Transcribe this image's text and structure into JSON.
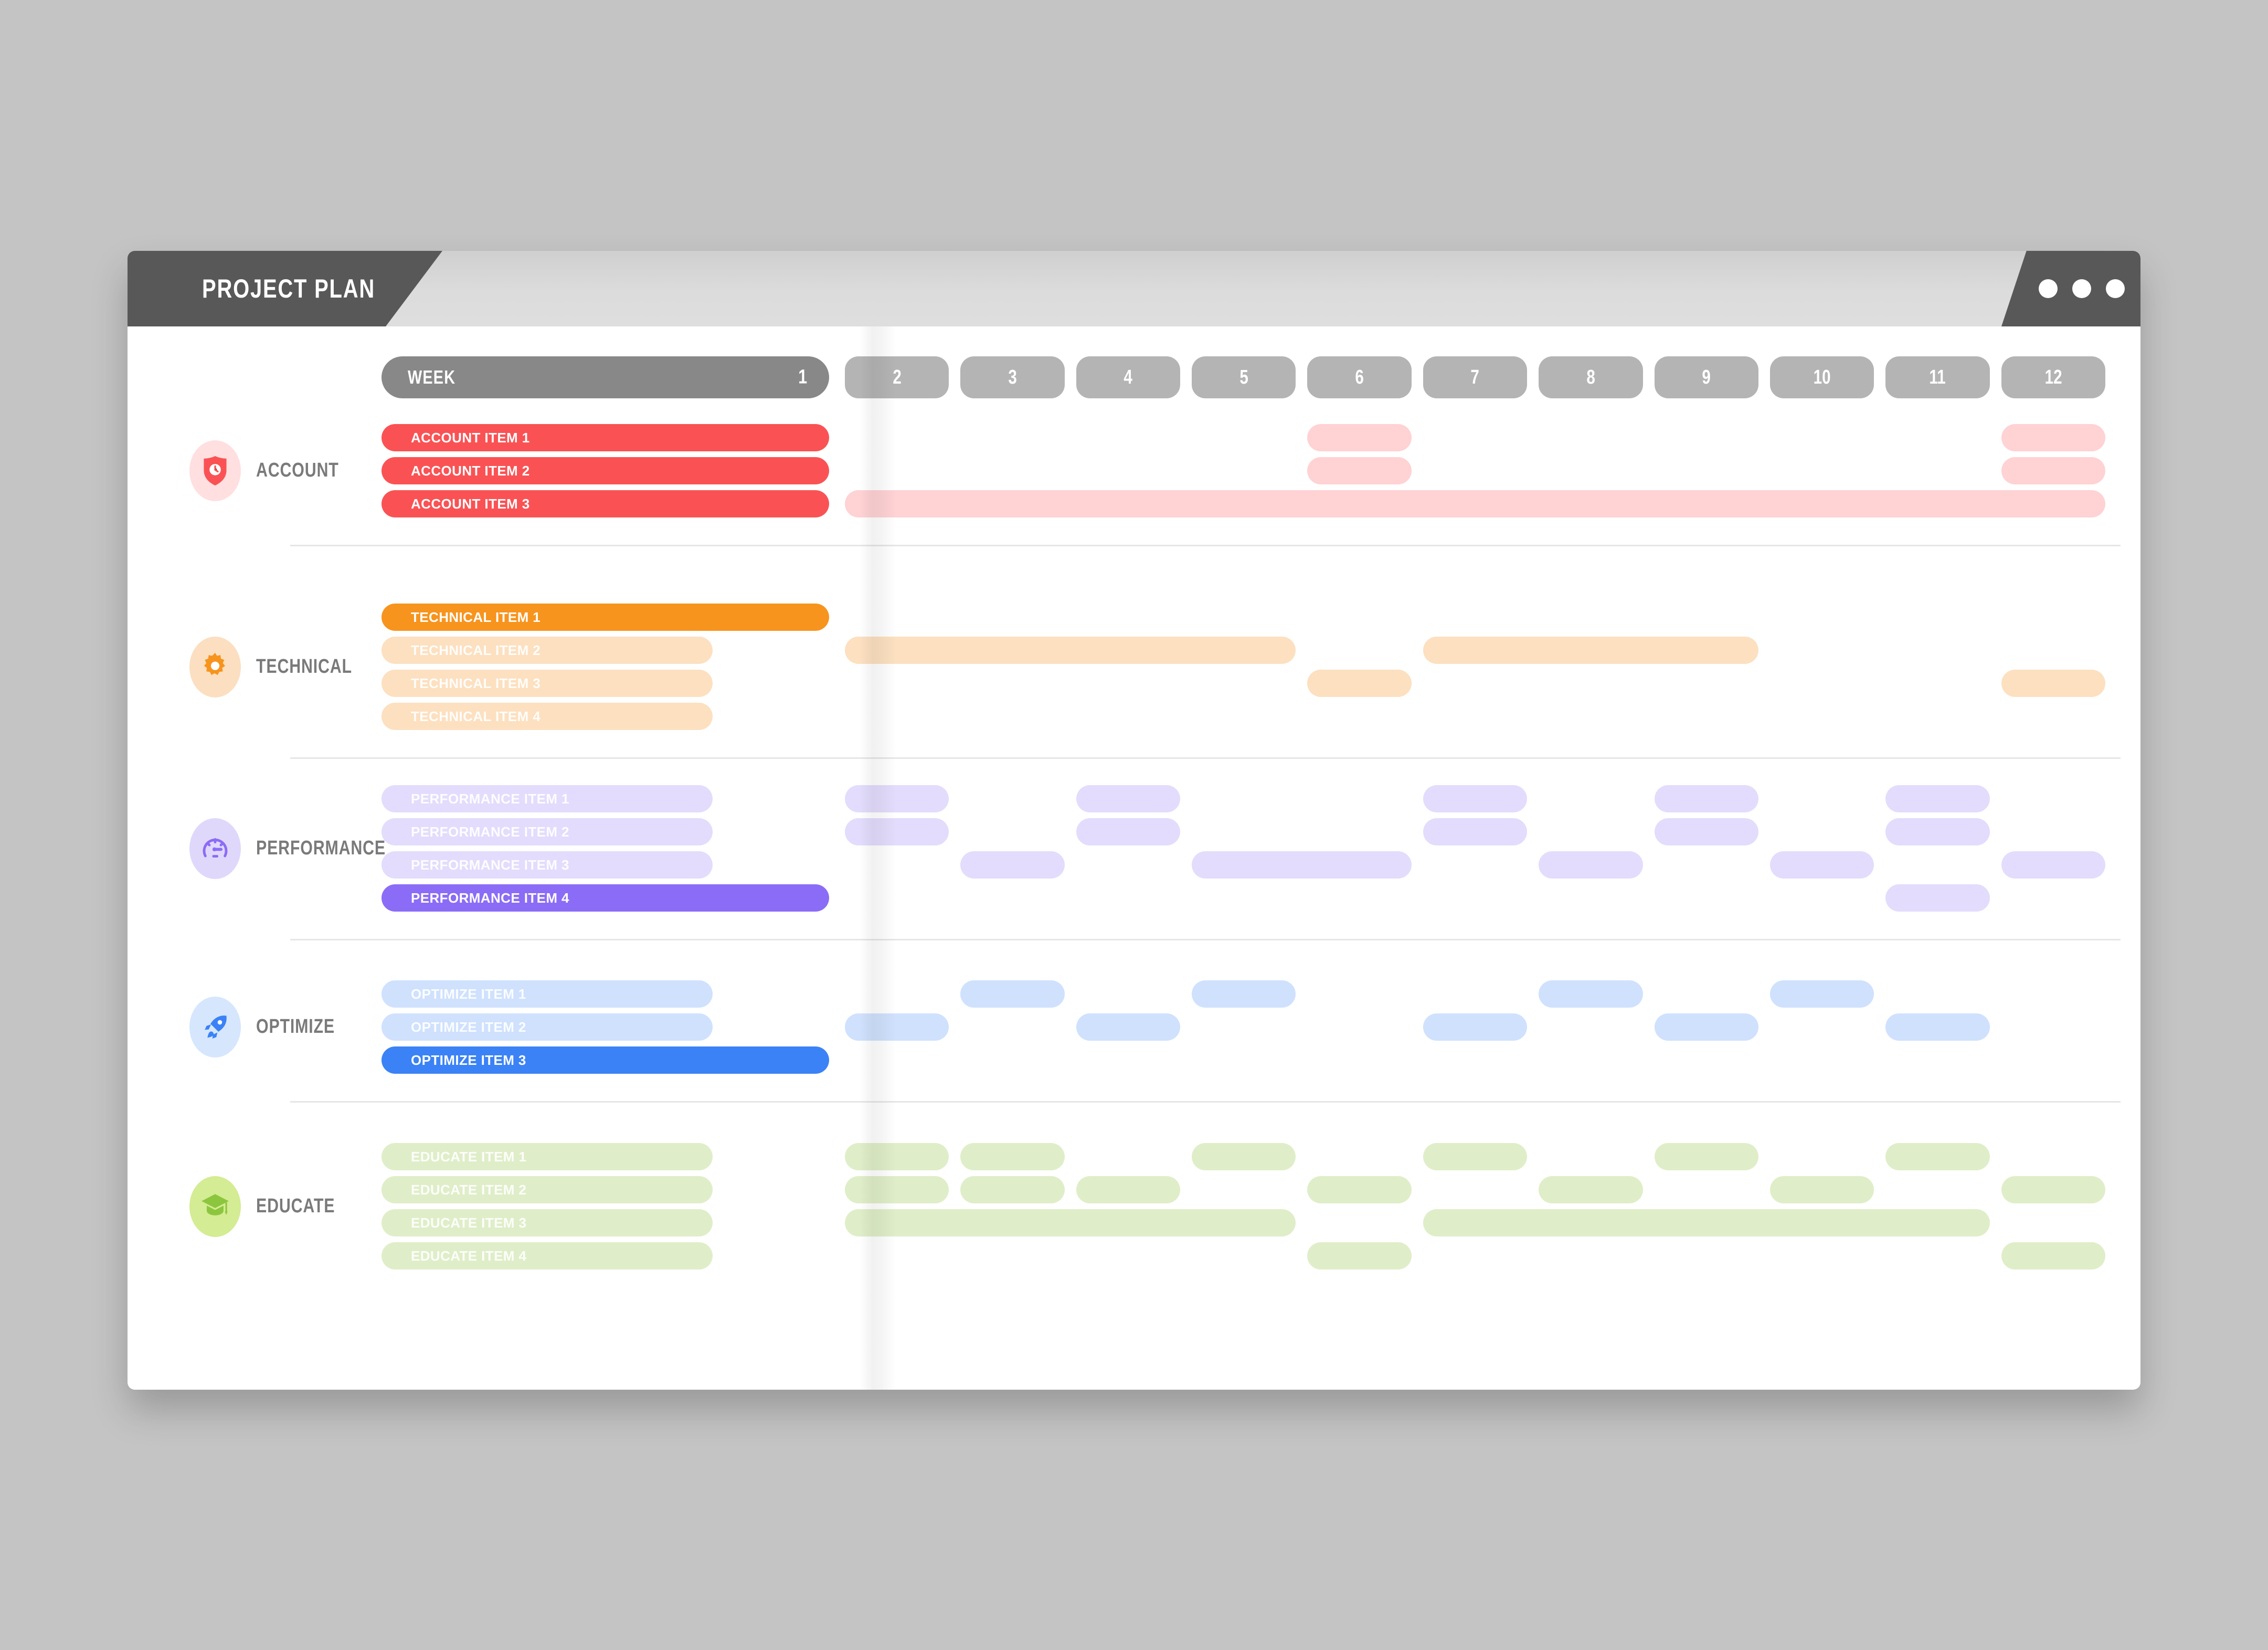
{
  "window": {
    "title": "PROJECT PLAN",
    "menu_icon": "ellipsis-icon",
    "dots": [
      "dot-1",
      "dot-2",
      "dot-3"
    ]
  },
  "timeline": {
    "week_label": "WEEK",
    "current_week": "1",
    "weeks": [
      "2",
      "3",
      "4",
      "5",
      "6",
      "7",
      "8",
      "9",
      "10",
      "11",
      "12"
    ]
  },
  "chart_data": {
    "type": "bar",
    "title": "PROJECT PLAN",
    "xlabel": "WEEK",
    "categories": [
      "1",
      "2",
      "3",
      "4",
      "5",
      "6",
      "7",
      "8",
      "9",
      "10",
      "11",
      "12"
    ],
    "groups": [
      {
        "name": "ACCOUNT",
        "icon": "shield-clock-icon",
        "color": "#fa5254",
        "light": "#ffd2d4",
        "icon_bg": "#ffdfe0",
        "tasks": [
          {
            "label": "ACCOUNT ITEM 1",
            "active": true,
            "spans": [
              [
                6,
                6
              ],
              [
                12,
                12
              ]
            ]
          },
          {
            "label": "ACCOUNT ITEM 2",
            "active": true,
            "spans": [
              [
                6,
                6
              ],
              [
                12,
                12
              ]
            ]
          },
          {
            "label": "ACCOUNT ITEM 3",
            "active": true,
            "spans": [
              [
                2,
                12
              ]
            ]
          }
        ]
      },
      {
        "name": "TECHNICAL",
        "icon": "gear-icon",
        "color": "#f7941e",
        "light": "#fce0c0",
        "icon_bg": "#fbdfc0",
        "tasks": [
          {
            "label": "TECHNICAL ITEM 1",
            "active": true,
            "spans": []
          },
          {
            "label": "TECHNICAL ITEM 2",
            "active": false,
            "spans": [
              [
                2,
                5
              ],
              [
                7,
                9
              ]
            ]
          },
          {
            "label": "TECHNICAL ITEM 3",
            "active": false,
            "spans": [
              [
                6,
                6
              ],
              [
                12,
                12
              ]
            ]
          },
          {
            "label": "TECHNICAL ITEM 4",
            "active": false,
            "spans": []
          }
        ]
      },
      {
        "name": "PERFORMANCE",
        "icon": "gauge-icon",
        "color": "#8b6cf6",
        "light": "#e3dcfc",
        "icon_bg": "#e0d8fb",
        "tasks": [
          {
            "label": "PERFORMANCE ITEM 1",
            "active": false,
            "spans": [
              [
                2,
                2
              ],
              [
                4,
                4
              ],
              [
                7,
                7
              ],
              [
                9,
                9
              ],
              [
                11,
                11
              ]
            ]
          },
          {
            "label": "PERFORMANCE ITEM 2",
            "active": false,
            "spans": [
              [
                2,
                2
              ],
              [
                4,
                4
              ],
              [
                7,
                7
              ],
              [
                9,
                9
              ],
              [
                11,
                11
              ]
            ]
          },
          {
            "label": "PERFORMANCE ITEM 3",
            "active": false,
            "spans": [
              [
                3,
                3
              ],
              [
                5,
                6
              ],
              [
                8,
                8
              ],
              [
                10,
                10
              ],
              [
                12,
                12
              ]
            ]
          },
          {
            "label": "PERFORMANCE ITEM 4",
            "active": true,
            "spans": [
              [
                11,
                11
              ]
            ]
          }
        ]
      },
      {
        "name": "OPTIMIZE",
        "icon": "rocket-icon",
        "color": "#3b82f6",
        "light": "#cfe1fd",
        "icon_bg": "#d6e6fd",
        "tasks": [
          {
            "label": "OPTIMIZE ITEM 1",
            "active": false,
            "spans": [
              [
                3,
                3
              ],
              [
                5,
                5
              ],
              [
                8,
                8
              ],
              [
                10,
                10
              ]
            ]
          },
          {
            "label": "OPTIMIZE ITEM 2",
            "active": false,
            "spans": [
              [
                2,
                2
              ],
              [
                4,
                4
              ],
              [
                7,
                7
              ],
              [
                9,
                9
              ],
              [
                11,
                11
              ]
            ]
          },
          {
            "label": "OPTIMIZE ITEM 3",
            "active": true,
            "spans": []
          }
        ]
      },
      {
        "name": "EDUCATE",
        "icon": "graduation-cap-icon",
        "color": "#8cc63e",
        "light": "#dfeec8",
        "icon_bg": "#d4ec93",
        "tasks": [
          {
            "label": "EDUCATE ITEM 1",
            "active": false,
            "spans": [
              [
                2,
                2
              ],
              [
                3,
                3
              ],
              [
                5,
                5
              ],
              [
                7,
                7
              ],
              [
                9,
                9
              ],
              [
                11,
                11
              ]
            ]
          },
          {
            "label": "EDUCATE ITEM 2",
            "active": false,
            "spans": [
              [
                2,
                2
              ],
              [
                3,
                3
              ],
              [
                4,
                4
              ],
              [
                6,
                6
              ],
              [
                8,
                8
              ],
              [
                10,
                10
              ],
              [
                12,
                12
              ]
            ]
          },
          {
            "label": "EDUCATE ITEM 3",
            "active": false,
            "spans": [
              [
                2,
                5
              ],
              [
                7,
                11
              ]
            ]
          },
          {
            "label": "EDUCATE ITEM 4",
            "active": false,
            "spans": [
              [
                6,
                6
              ],
              [
                12,
                12
              ]
            ]
          }
        ]
      }
    ]
  }
}
